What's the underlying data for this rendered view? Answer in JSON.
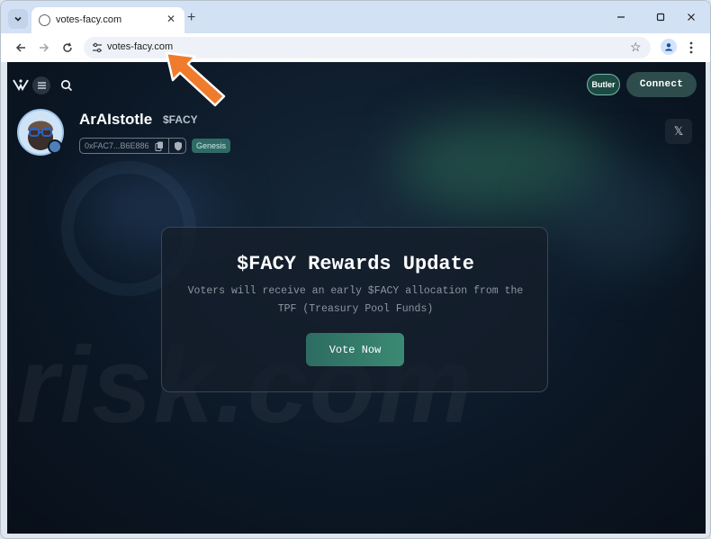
{
  "browser": {
    "tab": {
      "title": "votes-facy.com"
    },
    "address_bar": {
      "url": "votes-facy.com"
    }
  },
  "site": {
    "header": {
      "butler_label": "Butler",
      "connect_label": "Connect"
    },
    "token": {
      "name": "ArAIstotle",
      "ticker": "$FACY",
      "address": "0xFAC7...B6E886",
      "tag": "Genesis"
    },
    "social": {
      "x_label": "𝕏"
    },
    "card": {
      "title": "$FACY Rewards Update",
      "body": "Voters will receive an early $FACY allocation from the TPF (Treasury Pool Funds)",
      "button_label": "Vote Now"
    }
  },
  "watermark": {
    "text": "risk.com"
  },
  "colors": {
    "accent": "#2f6a66",
    "button": "#3b8a72",
    "annotation_arrow": "#f07b2c",
    "page_bg": "#0c1826"
  },
  "icons": [
    "chevron-down-icon",
    "globe-icon",
    "close-icon",
    "plus-icon",
    "minimize-icon",
    "maximize-icon",
    "back-icon",
    "forward-icon",
    "reload-icon",
    "site-info-icon",
    "star-icon",
    "profile-icon",
    "kebab-icon",
    "logo-icon",
    "menu-icon",
    "search-icon",
    "copy-icon",
    "shield-icon",
    "x-icon"
  ]
}
